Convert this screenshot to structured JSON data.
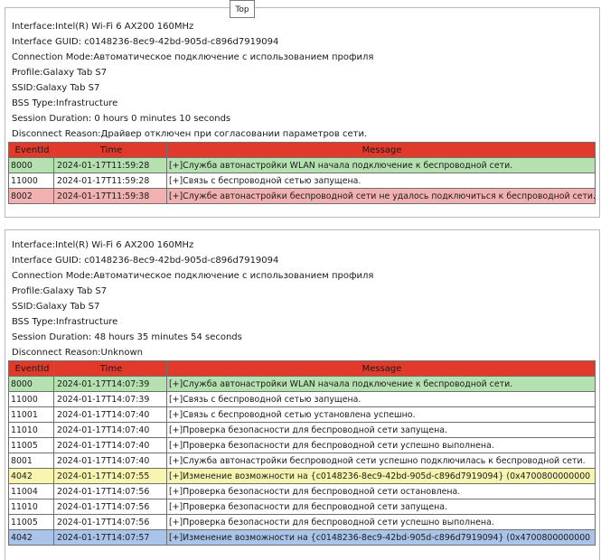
{
  "top_button": "Top",
  "table_headers": {
    "eventid": "EventId",
    "time": "Time",
    "message": "Message"
  },
  "sessions": [
    {
      "info": [
        {
          "label": "Interface:",
          "value": "Intel(R) Wi-Fi 6 AX200 160MHz"
        },
        {
          "label": "Interface GUID: ",
          "value": "c0148236-8ec9-42bd-905d-c896d7919094"
        },
        {
          "label": "Connection Mode:",
          "value": "Автоматическое подключение с использованием профиля"
        },
        {
          "label": "Profile:",
          "value": "Galaxy Tab S7"
        },
        {
          "label": "SSID:",
          "value": "Galaxy Tab S7"
        },
        {
          "label": "BSS Type:",
          "value": "Infrastructure"
        },
        {
          "label": "Session Duration: ",
          "value": "0 hours 0 minutes 10 seconds"
        },
        {
          "label": "Disconnect Reason:",
          "value": "Драйвер отключен при согласовании параметров сети."
        }
      ],
      "rows": [
        {
          "id": "8000",
          "time": "2024-01-17T11:59:28",
          "msg": "[+]Служба автонастройки WLAN начала подключение к беспроводной сети.",
          "color": "#b5e0b0"
        },
        {
          "id": "11000",
          "time": "2024-01-17T11:59:28",
          "msg": "[+]Связь с беспроводной сетью запущена.",
          "color": "#ffffff"
        },
        {
          "id": "8002",
          "time": "2024-01-17T11:59:38",
          "msg": "[+]Службе автонастройки беспроводной сети не удалось подключиться к беспроводной сети.",
          "color": "#f2b1b1"
        }
      ]
    },
    {
      "info": [
        {
          "label": "Interface:",
          "value": "Intel(R) Wi-Fi 6 AX200 160MHz"
        },
        {
          "label": "Interface GUID: ",
          "value": "c0148236-8ec9-42bd-905d-c896d7919094"
        },
        {
          "label": "Connection Mode:",
          "value": "Автоматическое подключение с использованием профиля"
        },
        {
          "label": "Profile:",
          "value": "Galaxy Tab S7"
        },
        {
          "label": "SSID:",
          "value": "Galaxy Tab S7"
        },
        {
          "label": "BSS Type:",
          "value": "Infrastructure"
        },
        {
          "label": "Session Duration: ",
          "value": "48 hours 35 minutes 54 seconds"
        },
        {
          "label": "Disconnect Reason:",
          "value": "Unknown"
        }
      ],
      "rows": [
        {
          "id": "8000",
          "time": "2024-01-17T14:07:39",
          "msg": "[+]Служба автонастройки WLAN начала подключение к беспроводной сети.",
          "color": "#b5e0b0"
        },
        {
          "id": "11000",
          "time": "2024-01-17T14:07:39",
          "msg": "[+]Связь с беспроводной сетью запущена.",
          "color": "#ffffff"
        },
        {
          "id": "11001",
          "time": "2024-01-17T14:07:40",
          "msg": "[+]Связь с беспроводной сетью установлена успешно.",
          "color": "#ffffff"
        },
        {
          "id": "11010",
          "time": "2024-01-17T14:07:40",
          "msg": "[+]Проверка безопасности для беспроводной сети запущена.",
          "color": "#ffffff"
        },
        {
          "id": "11005",
          "time": "2024-01-17T14:07:40",
          "msg": "[+]Проверка безопасности для беспроводной сети успешно выполнена.",
          "color": "#ffffff"
        },
        {
          "id": "8001",
          "time": "2024-01-17T14:07:40",
          "msg": "[+]Служба автонастройки беспроводной сети успешно подключилась к беспроводной сети.",
          "color": "#ffffff"
        },
        {
          "id": "4042",
          "time": "2024-01-17T14:07:55",
          "msg": "[+]Изменение возможности на {c0148236-8ec9-42bd-905d-c896d7919094} (0x4700800000000",
          "color": "#f7f5b0"
        },
        {
          "id": "11004",
          "time": "2024-01-17T14:07:56",
          "msg": "[+]Проверка безопасности для беспроводной сети остановлена.",
          "color": "#ffffff"
        },
        {
          "id": "11010",
          "time": "2024-01-17T14:07:56",
          "msg": "[+]Проверка безопасности для беспроводной сети запущена.",
          "color": "#ffffff"
        },
        {
          "id": "11005",
          "time": "2024-01-17T14:07:56",
          "msg": "[+]Проверка безопасности для беспроводной сети успешно выполнена.",
          "color": "#ffffff"
        },
        {
          "id": "4042",
          "time": "2024-01-17T14:07:57",
          "msg": "[+]Изменение возможности на {c0148236-8ec9-42bd-905d-c896d7919094} (0x4700800000000",
          "color": "#a9c4e8"
        }
      ]
    }
  ]
}
